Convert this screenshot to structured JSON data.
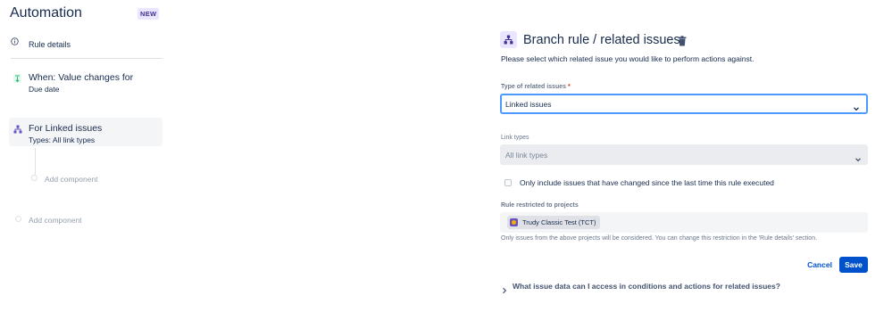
{
  "app": {
    "title": "Automation",
    "badge": "NEW"
  },
  "sidebar": {
    "rule_details": {
      "label": "Rule details",
      "icon": "info-icon"
    },
    "trigger": {
      "title": "When: Value changes for",
      "subtitle": "Due date",
      "icon": "trigger-icon"
    },
    "branch": {
      "title": "For Linked issues",
      "subtitle": "Types: All link types",
      "icon": "branch-icon"
    },
    "add_component_nested": "Add component",
    "add_component": "Add component"
  },
  "panel": {
    "title": "Branch rule / related issues",
    "description": "Please select which related issue you would like to perform actions against.",
    "type_field": {
      "label": "Type of related issues",
      "required_mark": "*",
      "value": "Linked issues"
    },
    "link_types_field": {
      "label": "Link types",
      "placeholder": "All link types"
    },
    "checkbox": {
      "label": "Only include issues that have changed since the last time this rule executed",
      "checked": false
    },
    "projects_field": {
      "label": "Rule restricted to projects",
      "project": "Trudy Classic Test (TCT)"
    },
    "note": "Only issues from the above projects will be considered. You can change this restriction in the 'Rule details' section.",
    "cancel_label": "Cancel",
    "save_label": "Save",
    "faq": "What issue data can I access in conditions and actions for related issues?"
  },
  "colors": {
    "primary": "#0052cc",
    "focus_border": "#4c9aff",
    "badge_bg": "#eae6ff",
    "badge_text": "#403294",
    "trigger_green": "#36b37e",
    "branch_purple": "#6554c0",
    "required_red": "#de350b"
  }
}
